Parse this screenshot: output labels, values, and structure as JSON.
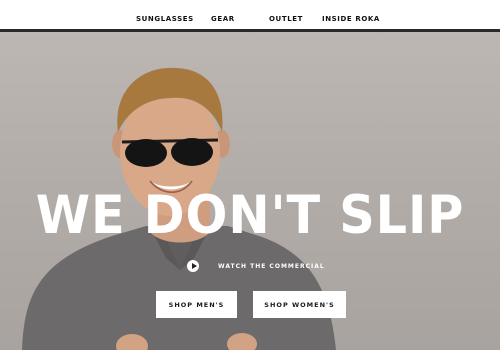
{
  "nav": {
    "items": [
      {
        "label": "SUNGLASSES"
      },
      {
        "label": "GEAR"
      },
      {
        "label": "OUTLET"
      },
      {
        "label": "INSIDE ROKA"
      }
    ]
  },
  "hero": {
    "headline": "WE DON'T SLIP",
    "watch_label": "WATCH THE COMMERCIAL",
    "watch_icon": "play-icon",
    "shop_mens_label": "SHOP MEN'S",
    "shop_womens_label": "SHOP WOMEN'S"
  },
  "colors": {
    "hero_background": "#b3ada9",
    "text_light": "#ffffff",
    "nav_text": "#111111",
    "nav_rule": "#2a2a2a",
    "shirt": "#6c6a6a"
  }
}
